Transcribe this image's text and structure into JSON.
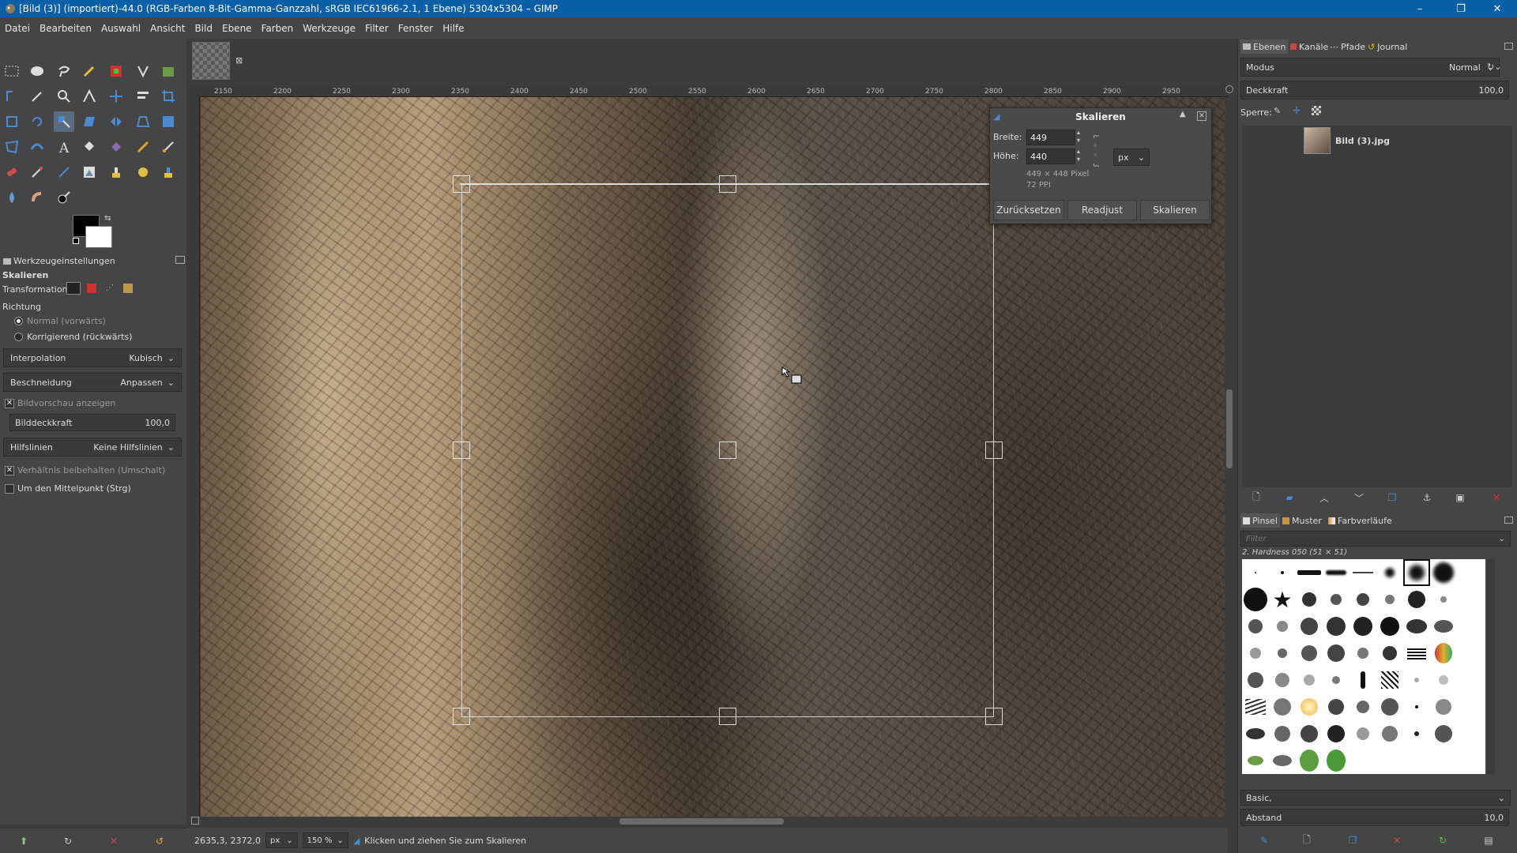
{
  "window": {
    "title": "[Bild (3)] (importiert)-44.0 (RGB-Farben 8-Bit-Gamma-Ganzzahl, sRGB IEC61966-2.1, 1 Ebene) 5304x5304 – GIMP",
    "minimize": "–",
    "maximize": "❐",
    "close": "✕"
  },
  "menu": [
    "Datei",
    "Bearbeiten",
    "Auswahl",
    "Ansicht",
    "Bild",
    "Ebene",
    "Farben",
    "Werkzeuge",
    "Filter",
    "Fenster",
    "Hilfe"
  ],
  "tool_options": {
    "tab_label": "Werkzeugeinstellungen",
    "tool_name": "Skalieren",
    "transformation_label": "Transformation:",
    "direction_label": "Richtung",
    "direction_options": [
      "Normal (vorwärts)",
      "Korrigierend (rückwärts)"
    ],
    "interpolation_label": "Interpolation",
    "interpolation_value": "Kubisch",
    "clipping_label": "Beschneidung",
    "clipping_value": "Anpassen",
    "show_preview_label": "Bildvorschau anzeigen",
    "image_opacity_label": "Bilddeckkraft",
    "image_opacity_value": "100,0",
    "guides_label": "Hilfslinien",
    "guides_value": "Keine Hilfslinien",
    "keep_aspect_label": "Verhältnis beibehalten (Umschalt)",
    "around_center_label": "Um den Mittelpunkt (Strg)"
  },
  "ruler_top": [
    "2150",
    "2200",
    "2250",
    "2300",
    "2350",
    "2400",
    "2450",
    "2500",
    "2550",
    "2600",
    "2650",
    "2700",
    "2750",
    "2800",
    "2850",
    "2900",
    "2950"
  ],
  "scale_dialog": {
    "title": "Skalieren",
    "width_label": "Breite:",
    "width_value": "449",
    "height_label": "Höhe:",
    "height_value": "440",
    "unit": "px",
    "info_size": "449 × 448 Pixel",
    "info_ppi": "72 PPI",
    "btn_reset": "Zurücksetzen",
    "btn_readjust": "Readjust",
    "btn_scale": "Skalieren"
  },
  "status": {
    "coords": "2635,3, 2372,0",
    "unit": "px",
    "zoom": "150 %",
    "message": "Klicken und ziehen Sie zum Skalieren"
  },
  "layers_panel": {
    "tabs": [
      "Ebenen",
      "Kanäle",
      "Pfade",
      "Journal"
    ],
    "mode_label": "Modus",
    "mode_value": "Normal",
    "opacity_label": "Deckkraft",
    "opacity_value": "100,0",
    "lock_label": "Sperre:",
    "layer_name": "Bild (3).jpg"
  },
  "brushes_panel": {
    "tabs": [
      "Pinsel",
      "Muster",
      "Farbverläufe"
    ],
    "filter_placeholder": "Filter",
    "selected_brush": "2. Hardness 050 (51 × 51)",
    "preset": "Basic,",
    "spacing_label": "Abstand",
    "spacing_value": "10,0"
  },
  "colors": {
    "accent": "#0a5fa8",
    "foreground": "#000000",
    "background": "#ffffff"
  }
}
